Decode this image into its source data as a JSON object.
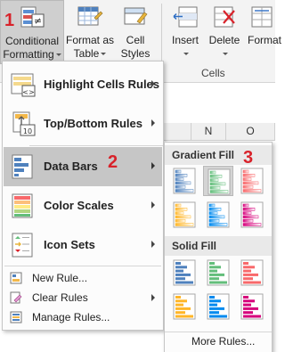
{
  "ribbon": {
    "conditional_formatting": {
      "line1": "Conditional",
      "line2": "Formatting"
    },
    "format_as_table": {
      "line1": "Format as",
      "line2": "Table"
    },
    "cell_styles": {
      "line1": "Cell",
      "line2": "Styles"
    },
    "insert": "Insert",
    "delete": "Delete",
    "format": "Format",
    "cells_group": "Cells"
  },
  "columns": [
    "N",
    "O"
  ],
  "menu": {
    "items": [
      {
        "label": "Highlight Cells Rules",
        "icon": "highlight-cells-icon"
      },
      {
        "label": "Top/Bottom Rules",
        "icon": "top-bottom-icon"
      },
      {
        "label": "Data Bars",
        "icon": "data-bars-icon"
      },
      {
        "label": "Color Scales",
        "icon": "color-scales-icon"
      },
      {
        "label": "Icon Sets",
        "icon": "icon-sets-icon"
      }
    ],
    "small_items": [
      {
        "label": "New Rule...",
        "icon": "new-rule-icon"
      },
      {
        "label": "Clear Rules",
        "icon": "clear-rules-icon"
      },
      {
        "label": "Manage Rules...",
        "icon": "manage-rules-icon"
      }
    ]
  },
  "submenu": {
    "gradient_fill": "Gradient Fill",
    "solid_fill": "Solid Fill",
    "more_rules": "More Rules...",
    "colors": [
      "#4f81bd",
      "#63be7b",
      "#f8696b",
      "#ffb628",
      "#008aef",
      "#d6007b"
    ]
  },
  "steps": [
    "1",
    "2",
    "3"
  ]
}
